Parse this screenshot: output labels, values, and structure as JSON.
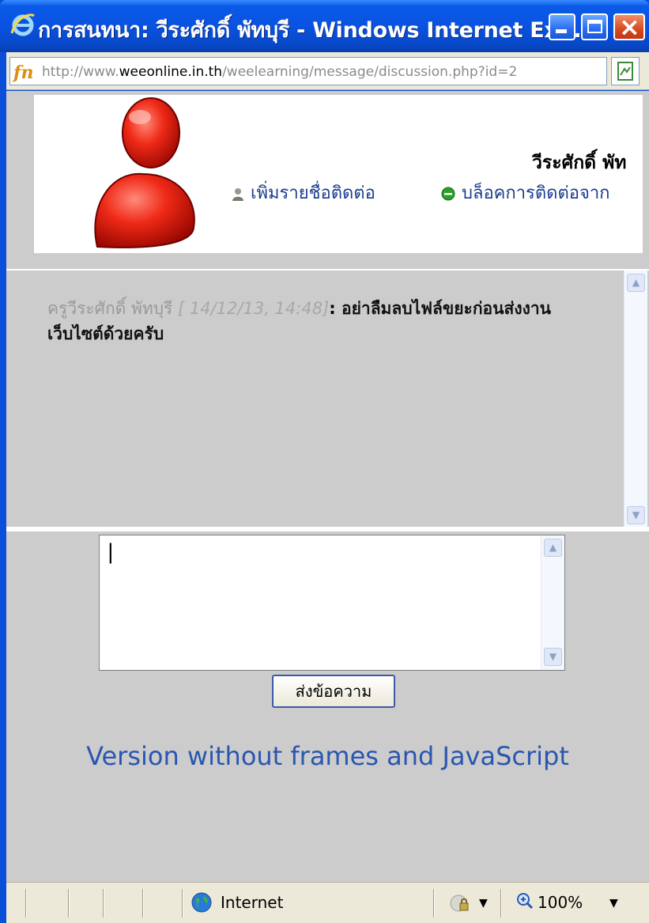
{
  "window": {
    "title": "การสนทนา: วีระศักดิ์ พัทบุรี - Windows Internet Ex..."
  },
  "address": {
    "url_prefix": "http://www.",
    "url_host": "weeonline.in.th",
    "url_path": "/weelearning/message/discussion.php?id=2"
  },
  "profile": {
    "name": "วีระศักดิ์ พัท",
    "add_contact_label": "เพิ่มรายชื่อติดต่อ",
    "block_contact_label": "บล็อคการติดต่อจาก"
  },
  "message": {
    "author": "ครูวีระศักดิ์ พัทบุรี",
    "timestamp": " [ 14/12/13, 14:48]",
    "separator": ":",
    "body": " อย่าลืมลบไฟล์ขยะก่อนส่งงานเว็บไซต์ด้วยครับ"
  },
  "compose": {
    "send_label": "ส่งข้อความ"
  },
  "noframes_link": "Version without frames and JavaScript",
  "statusbar": {
    "zone": "Internet",
    "zoom": "100%"
  },
  "icons": {
    "title": "internet-explorer-icon",
    "site": "site-favicon-icon",
    "avatar": "user-avatar-icon",
    "add_contact": "person-icon",
    "block": "green-circle-icon",
    "zone": "globe-icon",
    "zoom": "magnifier-icon"
  },
  "colors": {
    "titlebar": "#0a52e0",
    "link": "#1a3d8f",
    "content_bg": "#cccccc",
    "close_button": "#d84a20"
  }
}
